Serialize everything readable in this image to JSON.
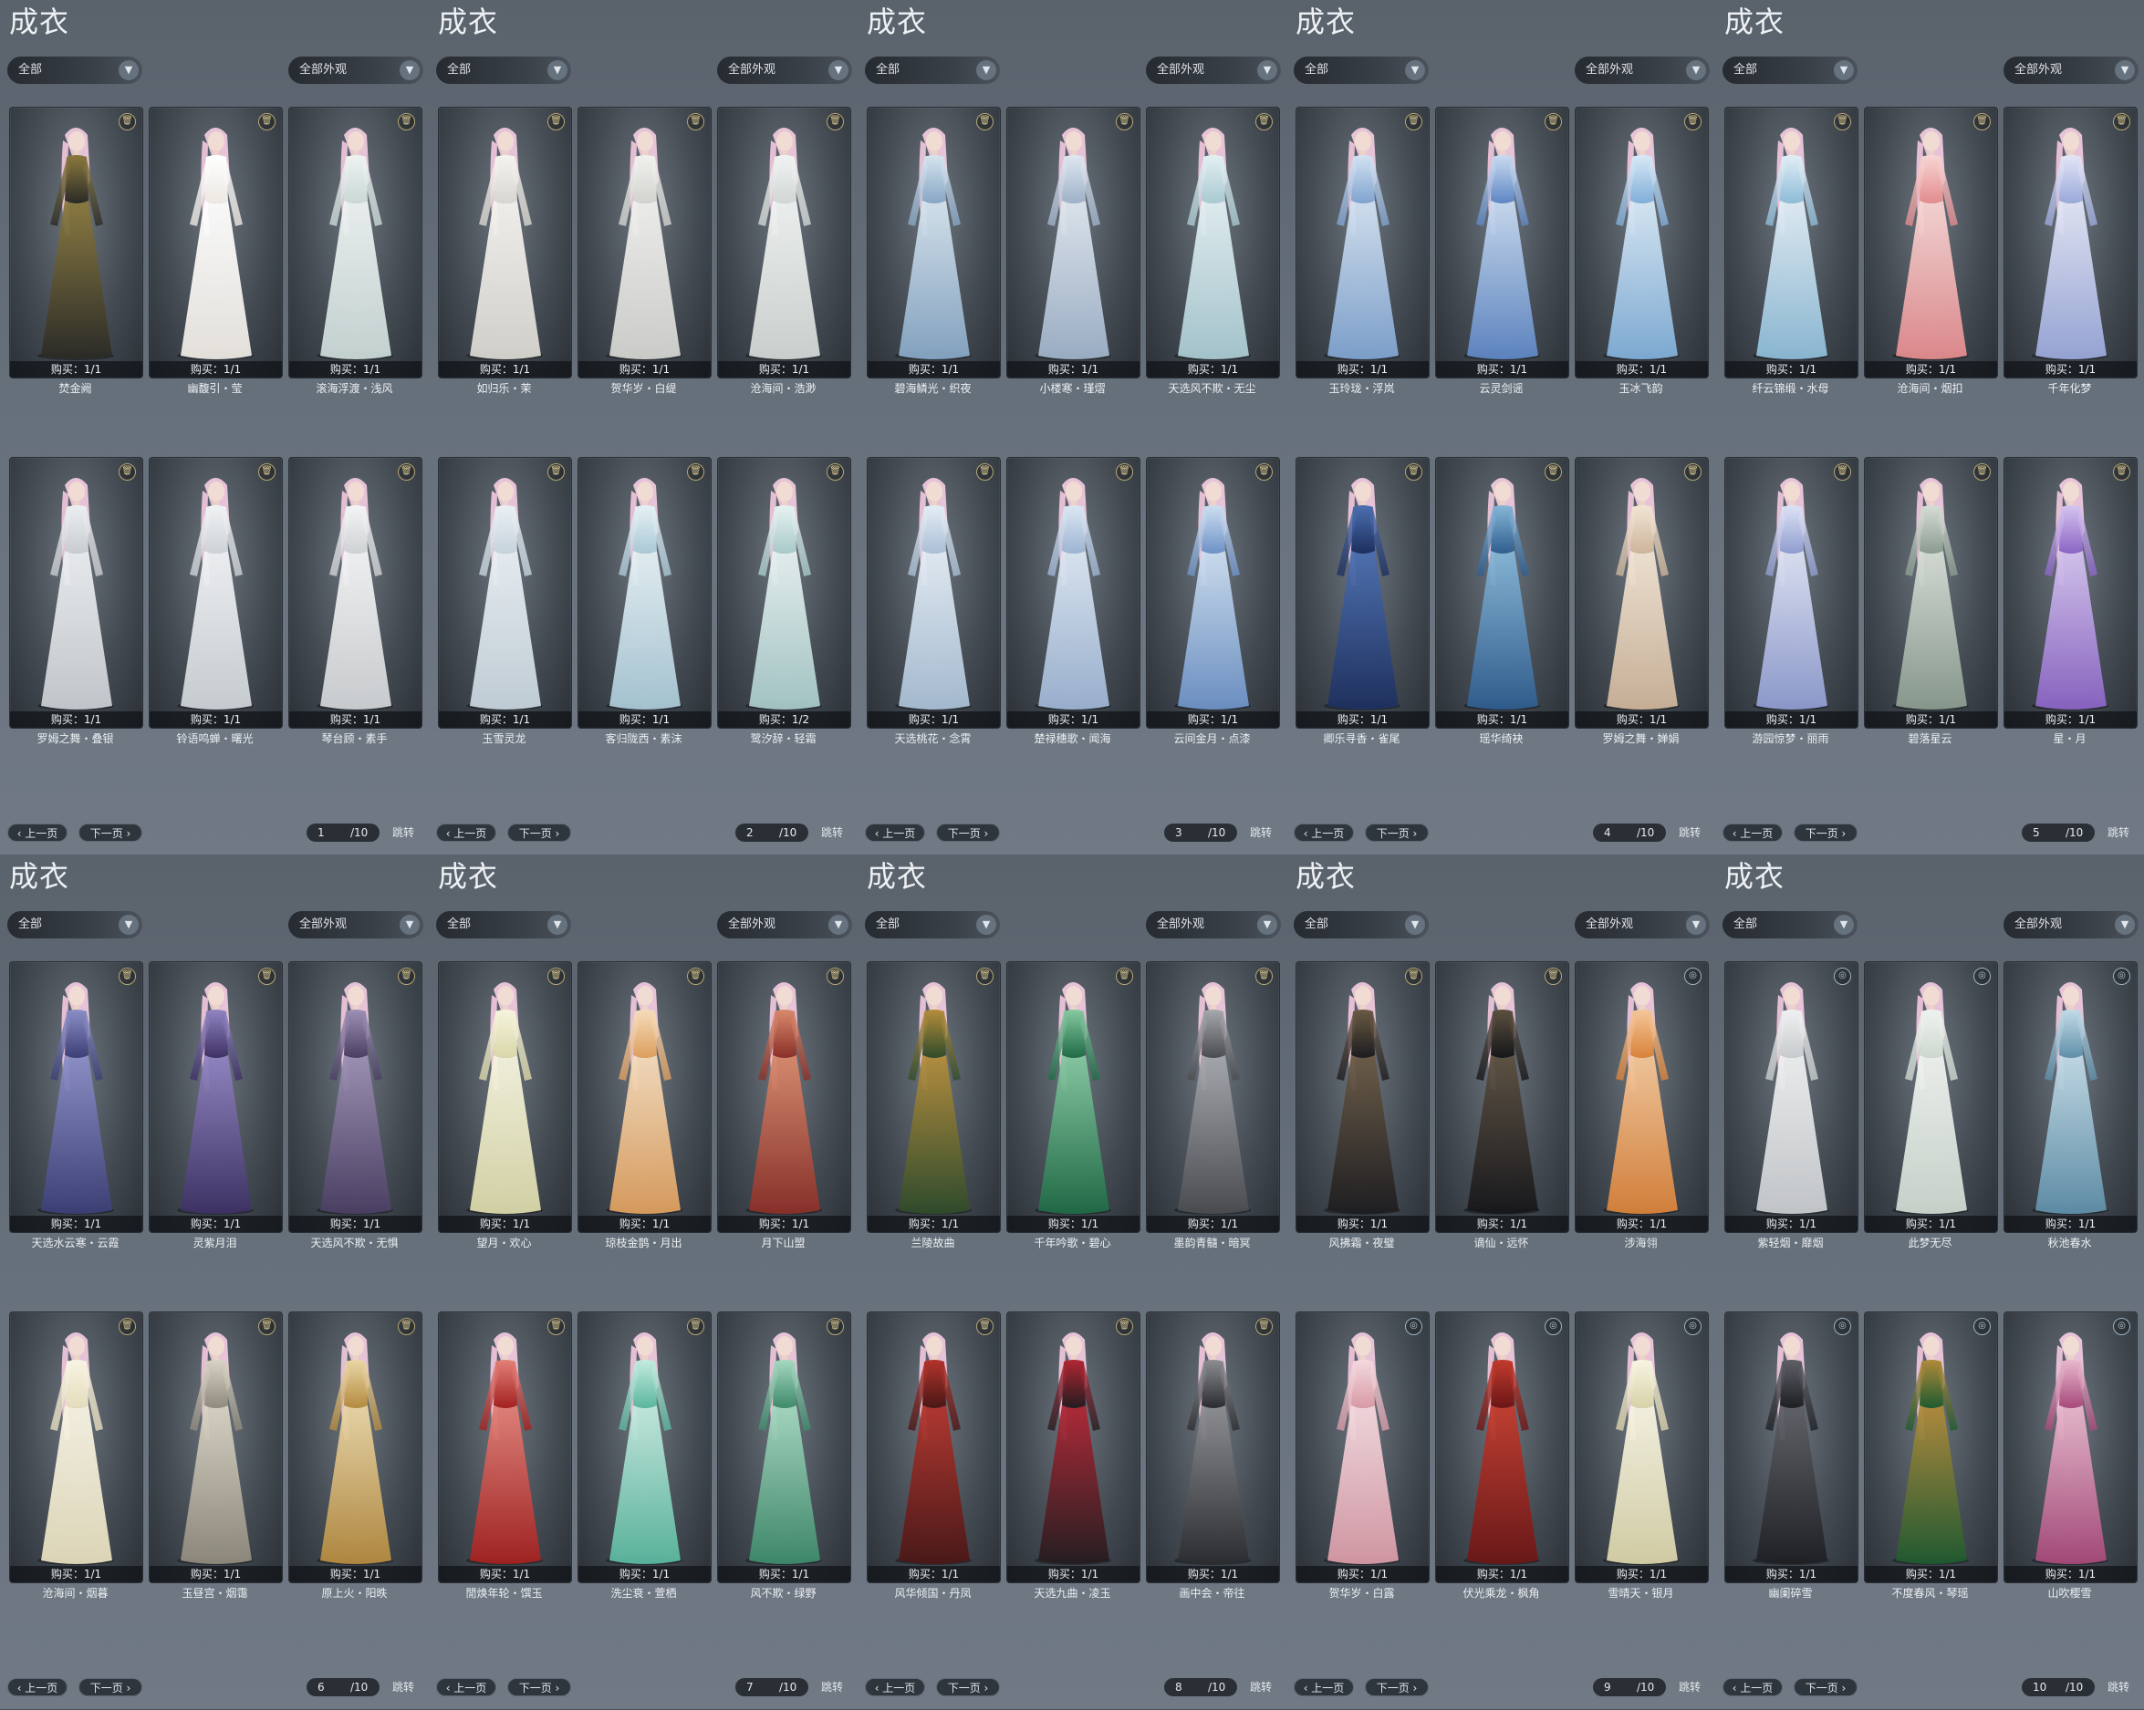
{
  "ui": {
    "title": "成衣",
    "filter1": "全部",
    "filter2": "全部外观",
    "prev_label": "上一页",
    "next_label": "下一页",
    "jump_label": "跳转",
    "total_pages": "/10",
    "icon_delete": "trash-icon",
    "icon_dropdown": "chevron-down-icon"
  },
  "panels": [
    {
      "page": "1",
      "items": [
        {
          "name": "焚金阙",
          "buy": "购买：1/1",
          "c1": "#2a2a26",
          "c2": "#8b7a3e",
          "icon": "trash"
        },
        {
          "name": "幽馥引・莹",
          "buy": "购买：1/1",
          "c1": "#ece8e2",
          "c2": "#ffffff",
          "icon": "trash"
        },
        {
          "name": "滚海浮渡・浅风",
          "buy": "购买：1/1",
          "c1": "#c9d8d6",
          "c2": "#eef3f2",
          "icon": "trash"
        },
        {
          "name": "罗姆之舞・叠银",
          "buy": "购买：1/1",
          "c1": "#c8ccd0",
          "c2": "#eceff1",
          "icon": "trash"
        },
        {
          "name": "铃语鸣蝉・曙光",
          "buy": "购买：1/1",
          "c1": "#cdd2d6",
          "c2": "#f1f3f5",
          "icon": "trash"
        },
        {
          "name": "琴台顾・素手",
          "buy": "购买：1/1",
          "c1": "#cfd2d4",
          "c2": "#f3f4f5",
          "icon": "trash"
        }
      ]
    },
    {
      "page": "2",
      "items": [
        {
          "name": "如归乐・茉",
          "buy": "购买：1/1",
          "c1": "#d8d6d0",
          "c2": "#f5f3ef",
          "icon": "trash"
        },
        {
          "name": "贺华岁・白缇",
          "buy": "购买：1/1",
          "c1": "#d2d3cf",
          "c2": "#f1f1ee",
          "icon": "trash"
        },
        {
          "name": "沧海间・浩渺",
          "buy": "购买：1/1",
          "c1": "#d1d6d4",
          "c2": "#f0f3f2",
          "icon": "trash"
        },
        {
          "name": "玉雪灵龙",
          "buy": "购买：1/1",
          "c1": "#c6d3dc",
          "c2": "#eaf0f4",
          "icon": "trash"
        },
        {
          "name": "客归陇西・素沫",
          "buy": "购买：1/1",
          "c1": "#a9c8d6",
          "c2": "#e6f1f5",
          "icon": "trash"
        },
        {
          "name": "鹭汐辞・轻霜",
          "buy": "购买：1/2",
          "c1": "#a7c9c8",
          "c2": "#e7f2f1",
          "icon": "trash"
        }
      ]
    },
    {
      "page": "3",
      "items": [
        {
          "name": "碧海鳞光・织夜",
          "buy": "购买：1/1",
          "c1": "#86a6c4",
          "c2": "#d6e4ee",
          "icon": "trash"
        },
        {
          "name": "小楼寒・瑾熠",
          "buy": "购买：1/1",
          "c1": "#9fb2c9",
          "c2": "#dfe7ef",
          "icon": "trash"
        },
        {
          "name": "天选风不欺・无尘",
          "buy": "购买：1/1",
          "c1": "#a9c9d1",
          "c2": "#e3f0f3",
          "icon": "trash"
        },
        {
          "name": "天选桃花・念霄",
          "buy": "购买：1/1",
          "c1": "#a9bfd5",
          "c2": "#e4edf5",
          "icon": "trash"
        },
        {
          "name": "楚禄穗歌・闻海",
          "buy": "购买：1/1",
          "c1": "#9db4d3",
          "c2": "#dce7f3",
          "icon": "trash"
        },
        {
          "name": "云间金月・点漆",
          "buy": "购买：1/1",
          "c1": "#6d92c6",
          "c2": "#cddff1",
          "icon": "trash"
        }
      ]
    },
    {
      "page": "4",
      "items": [
        {
          "name": "玉玲珑・浮岚",
          "buy": "购买：1/1",
          "c1": "#7fa3cf",
          "c2": "#d3e2f1",
          "icon": "trash"
        },
        {
          "name": "云灵剑谣",
          "buy": "购买：1/1",
          "c1": "#5e86c4",
          "c2": "#c9dbf0",
          "icon": "trash"
        },
        {
          "name": "玉冰飞韵",
          "buy": "购买：1/1",
          "c1": "#80aed8",
          "c2": "#d8e9f6",
          "icon": "trash"
        },
        {
          "name": "卿乐寻香・雀尾",
          "buy": "购买：1/1",
          "c1": "#1d2f5e",
          "c2": "#4c6fb0",
          "icon": "trash"
        },
        {
          "name": "瑶华绮袂",
          "buy": "购买：1/1",
          "c1": "#2f5d8f",
          "c2": "#86b6d6",
          "icon": "trash"
        },
        {
          "name": "罗姆之舞・婵娟",
          "buy": "购买：1/1",
          "c1": "#cdb49a",
          "c2": "#f1e4d3",
          "icon": "trash"
        }
      ]
    },
    {
      "page": "5",
      "items": [
        {
          "name": "纤云锦缎・水母",
          "buy": "购买：1/1",
          "c1": "#8dbbd7",
          "c2": "#e2eef6",
          "icon": "trash"
        },
        {
          "name": "沧海间・烟扣",
          "buy": "购买：1/1",
          "c1": "#e38b8e",
          "c2": "#f7d6d4",
          "icon": "trash"
        },
        {
          "name": "千年化梦",
          "buy": "购买：1/1",
          "c1": "#9aa8da",
          "c2": "#e3e6f6",
          "icon": "trash"
        },
        {
          "name": "游园惊梦・丽雨",
          "buy": "购买：1/1",
          "c1": "#8f9cd0",
          "c2": "#dde2f4",
          "icon": "trash"
        },
        {
          "name": "碧落星云",
          "buy": "购买：1/1",
          "c1": "#8a9b8f",
          "c2": "#d6ddd6",
          "icon": "trash"
        },
        {
          "name": "星・月",
          "buy": "购买：1/1",
          "c1": "#8a64c4",
          "c2": "#d5c4ef",
          "icon": "trash"
        }
      ]
    },
    {
      "page": "6",
      "items": [
        {
          "name": "天选水云寒・云霞",
          "buy": "购买：1/1",
          "c1": "#3c3f76",
          "c2": "#8c8fc7",
          "icon": "trash"
        },
        {
          "name": "灵紫月泪",
          "buy": "购买：1/1",
          "c1": "#3d3164",
          "c2": "#9184c2",
          "icon": "trash"
        },
        {
          "name": "天选风不欺・无惧",
          "buy": "购买：1/1",
          "c1": "#4a3f63",
          "c2": "#9d90b4",
          "icon": "trash"
        },
        {
          "name": "沧海间・烟暮",
          "buy": "购买：1/1",
          "c1": "#e4dcbc",
          "c2": "#f8f4e4",
          "icon": "trash"
        },
        {
          "name": "玉昼宫・烟霭",
          "buy": "购买：1/1",
          "c1": "#8f8a7c",
          "c2": "#d8d3c4",
          "icon": "trash"
        },
        {
          "name": "原上火・阳昳",
          "buy": "购买：1/1",
          "c1": "#b48a3f",
          "c2": "#ead6a6",
          "icon": "trash"
        }
      ]
    },
    {
      "page": "7",
      "items": [
        {
          "name": "望月・欢心",
          "buy": "购买：1/1",
          "c1": "#d9d7a8",
          "c2": "#f5f4de",
          "icon": "trash"
        },
        {
          "name": "琼枝金鹊・月出",
          "buy": "购买：1/1",
          "c1": "#dd9e5e",
          "c2": "#f5dcbc",
          "icon": "trash"
        },
        {
          "name": "月下山盟",
          "buy": "购买：1/1",
          "c1": "#8a2f28",
          "c2": "#d98a6d",
          "icon": "trash"
        },
        {
          "name": "閒焕年轮・馔玉",
          "buy": "购买：1/1",
          "c1": "#a3211f",
          "c2": "#e28078",
          "icon": "trash"
        },
        {
          "name": "洗尘衰・萱栖",
          "buy": "购买：1/1",
          "c1": "#5ab79e",
          "c2": "#c5eadf",
          "icon": "trash"
        },
        {
          "name": "风不欺・绿野",
          "buy": "购买：1/1",
          "c1": "#3e8a6b",
          "c2": "#a6d8c0",
          "icon": "trash"
        }
      ]
    },
    {
      "page": "8",
      "items": [
        {
          "name": "兰陵故曲",
          "buy": "购买：1/1",
          "c1": "#2f4b2a",
          "c2": "#b48d3b",
          "icon": "trash"
        },
        {
          "name": "千年吟歌・碧心",
          "buy": "购买：1/1",
          "c1": "#1f6b46",
          "c2": "#86c9a1",
          "icon": "trash"
        },
        {
          "name": "墨韵青髓・暗冥",
          "buy": "购买：1/1",
          "c1": "#4a4c50",
          "c2": "#a6a8ad",
          "icon": "trash"
        },
        {
          "name": "风华倾国・丹凤",
          "buy": "购买：1/1",
          "c1": "#4a1716",
          "c2": "#b3342c",
          "icon": "trash"
        },
        {
          "name": "天选九曲・凌玉",
          "buy": "购买：1/1",
          "c1": "#241c1f",
          "c2": "#b02634",
          "icon": "trash"
        },
        {
          "name": "画中会・帝往",
          "buy": "购买：1/1",
          "c1": "#2b2c2f",
          "c2": "#8d8e92",
          "icon": "trash"
        }
      ]
    },
    {
      "page": "9",
      "items": [
        {
          "name": "风拂霜・夜璧",
          "buy": "购买：1/1",
          "c1": "#1d1c1f",
          "c2": "#6a5a45",
          "icon": "trash"
        },
        {
          "name": "谪仙・远怀",
          "buy": "购买：1/1",
          "c1": "#16161a",
          "c2": "#5c5040",
          "icon": "trash"
        },
        {
          "name": "涉海翎",
          "buy": "购买：1/1",
          "c1": "#d9823a",
          "c2": "#f4c79a",
          "icon": "cap"
        },
        {
          "name": "贺华岁・白露",
          "buy": "购买：1/1",
          "c1": "#d79aa6",
          "c2": "#f4d9de",
          "icon": "cap"
        },
        {
          "name": "伏光乘龙・枫角",
          "buy": "购买：1/1",
          "c1": "#6b1616",
          "c2": "#c23b2d",
          "icon": "cap"
        },
        {
          "name": "雪晴天・银月",
          "buy": "购买：1/1",
          "c1": "#d8d2a8",
          "c2": "#f7f4e2",
          "icon": "cap"
        }
      ]
    },
    {
      "page": "10",
      "items": [
        {
          "name": "紫轻烟・靡烟",
          "buy": "购买：1/1",
          "c1": "#c8cbcd",
          "c2": "#eef0f1",
          "icon": "cap"
        },
        {
          "name": "此梦无尽",
          "buy": "购买：1/1",
          "c1": "#cdd7cf",
          "c2": "#eff3ef",
          "icon": "cap"
        },
        {
          "name": "秋池春水",
          "buy": "购买：1/1",
          "c1": "#5f8fa9",
          "c2": "#c2dbe7",
          "icon": "cap"
        },
        {
          "name": "幽阑碎雪",
          "buy": "购买：1/1",
          "c1": "#1e1f23",
          "c2": "#5e6066",
          "icon": "cap"
        },
        {
          "name": "不度春风・琴瑶",
          "buy": "购买：1/1",
          "c1": "#1f5a2f",
          "c2": "#b08a3a",
          "icon": "cap"
        },
        {
          "name": "山吹樱雪",
          "buy": "购买：1/1",
          "c1": "#a7497a",
          "c2": "#e8b8cc",
          "icon": "cap"
        }
      ]
    }
  ]
}
